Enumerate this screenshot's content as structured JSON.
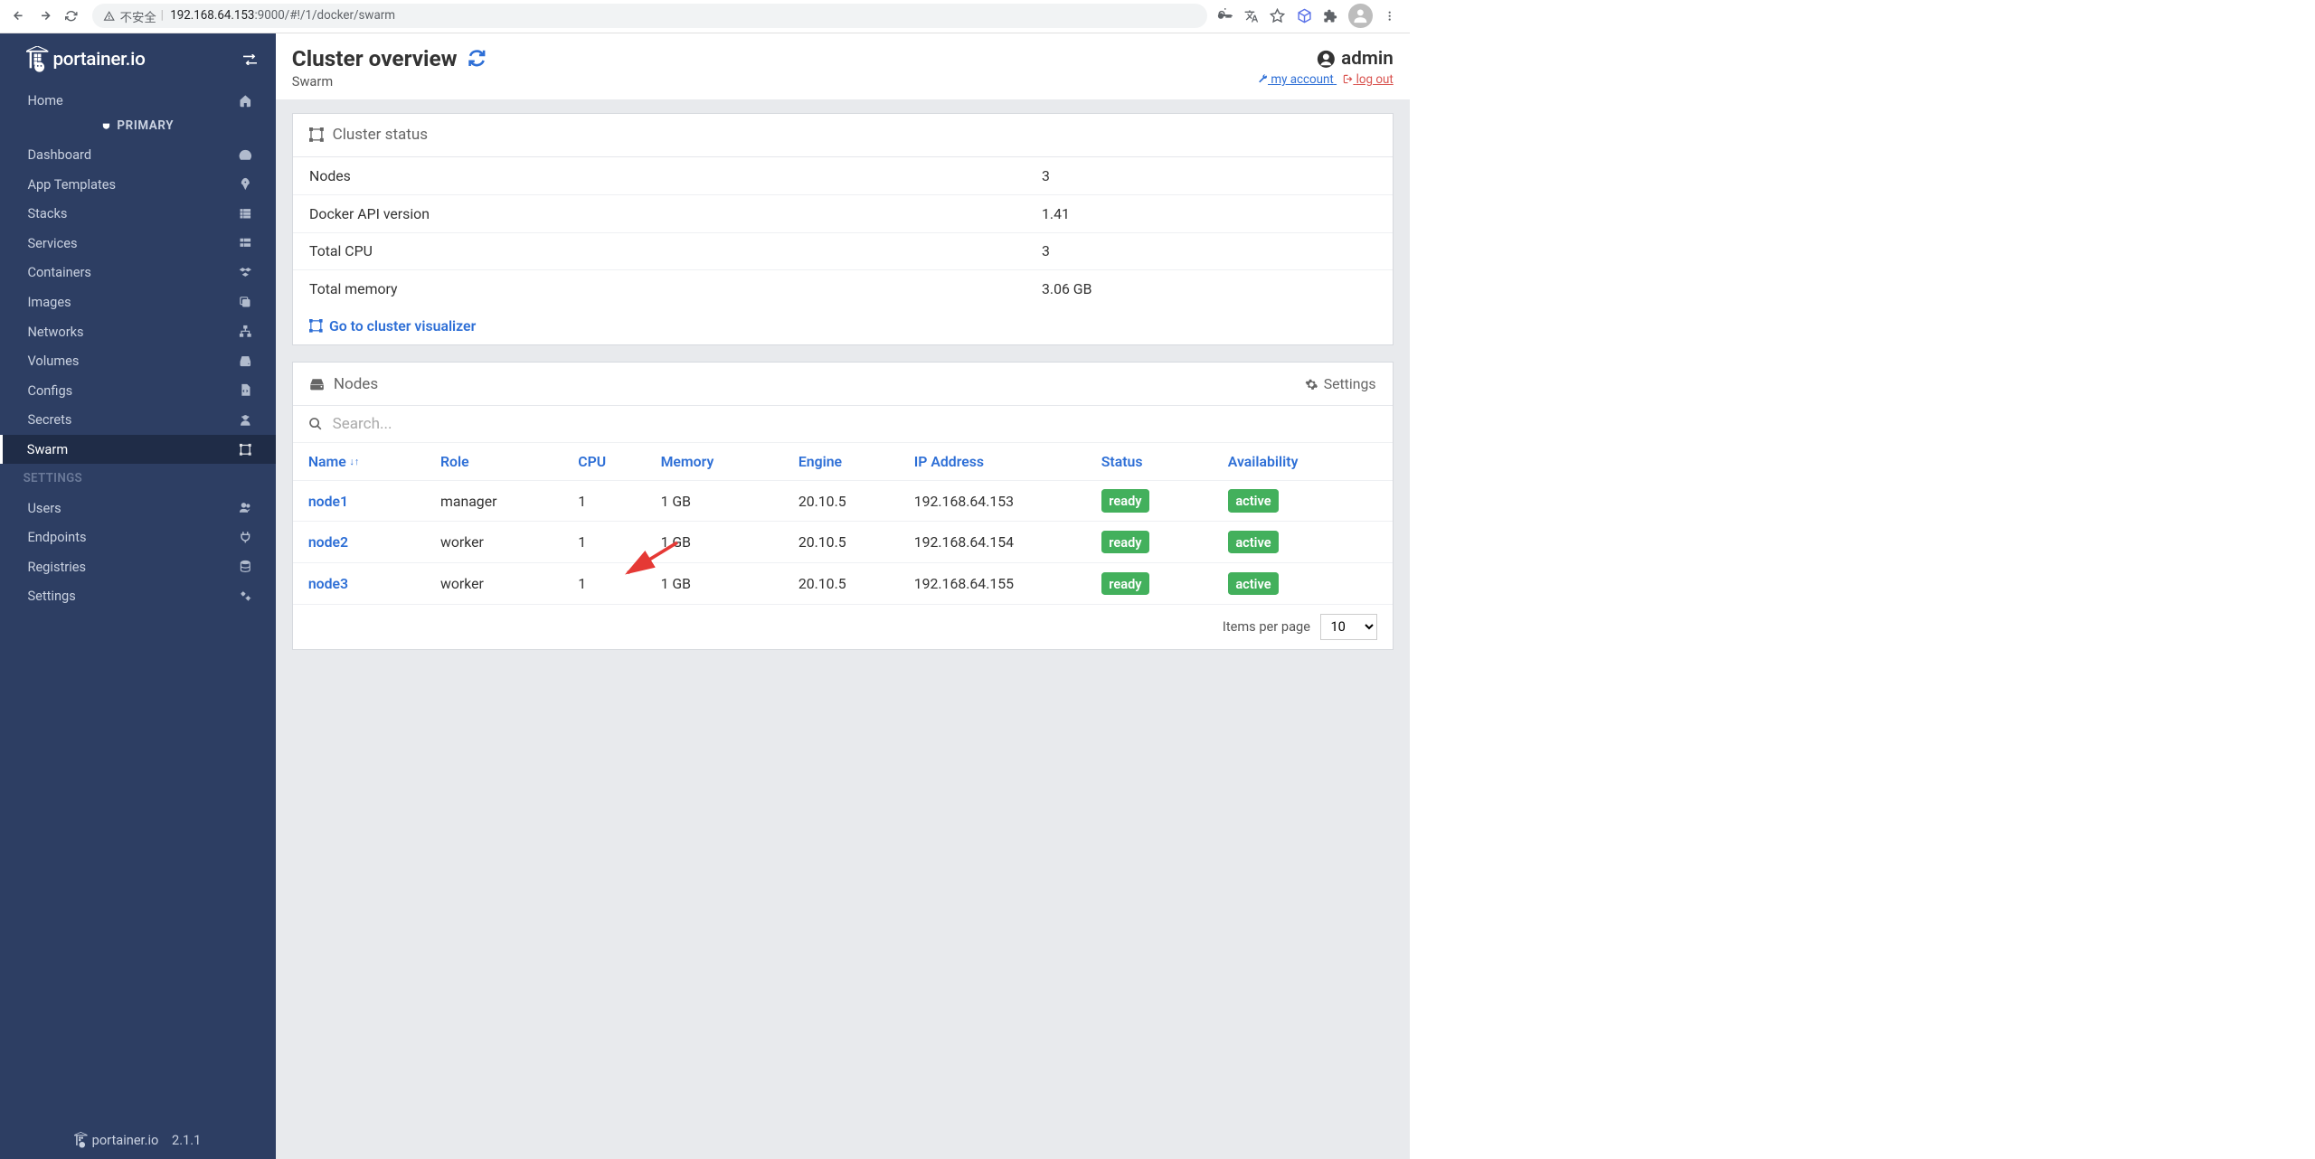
{
  "browser": {
    "insecure_label": "不安全",
    "url_host": "192.168.64.153",
    "url_port": ":9000",
    "url_path": "/#!/1/docker/swarm"
  },
  "sidebar": {
    "logo": "portainer.io",
    "env_label": "PRIMARY",
    "items": [
      {
        "label": "Home",
        "icon": "home"
      },
      {
        "label": "Dashboard",
        "icon": "tachometer"
      },
      {
        "label": "App Templates",
        "icon": "rocket"
      },
      {
        "label": "Stacks",
        "icon": "list"
      },
      {
        "label": "Services",
        "icon": "th-list"
      },
      {
        "label": "Containers",
        "icon": "cubes"
      },
      {
        "label": "Images",
        "icon": "clone"
      },
      {
        "label": "Networks",
        "icon": "sitemap"
      },
      {
        "label": "Volumes",
        "icon": "hdd"
      },
      {
        "label": "Configs",
        "icon": "file-code"
      },
      {
        "label": "Secrets",
        "icon": "user-secret"
      },
      {
        "label": "Swarm",
        "icon": "object-group"
      }
    ],
    "settings_label": "SETTINGS",
    "settings_items": [
      {
        "label": "Users",
        "icon": "users"
      },
      {
        "label": "Endpoints",
        "icon": "plug"
      },
      {
        "label": "Registries",
        "icon": "database"
      },
      {
        "label": "Settings",
        "icon": "cogs"
      }
    ],
    "footer_version": "2.1.1",
    "footer_logo": "portainer.io"
  },
  "header": {
    "title": "Cluster overview",
    "breadcrumb": "Swarm",
    "user": "admin",
    "my_account": "my account",
    "log_out": "log out"
  },
  "status_panel": {
    "title": "Cluster status",
    "rows": [
      {
        "key": "Nodes",
        "val": "3"
      },
      {
        "key": "Docker API version",
        "val": "1.41"
      },
      {
        "key": "Total CPU",
        "val": "3"
      },
      {
        "key": "Total memory",
        "val": "3.06 GB"
      }
    ],
    "visualizer": "Go to cluster visualizer"
  },
  "nodes_panel": {
    "title": "Nodes",
    "settings_label": "Settings",
    "search_placeholder": "Search...",
    "columns": [
      "Name",
      "Role",
      "CPU",
      "Memory",
      "Engine",
      "IP Address",
      "Status",
      "Availability"
    ],
    "rows": [
      {
        "name": "node1",
        "role": "manager",
        "cpu": "1",
        "memory": "1 GB",
        "engine": "20.10.5",
        "ip": "192.168.64.153",
        "status": "ready",
        "availability": "active"
      },
      {
        "name": "node2",
        "role": "worker",
        "cpu": "1",
        "memory": "1 GB",
        "engine": "20.10.5",
        "ip": "192.168.64.154",
        "status": "ready",
        "availability": "active"
      },
      {
        "name": "node3",
        "role": "worker",
        "cpu": "1",
        "memory": "1 GB",
        "engine": "20.10.5",
        "ip": "192.168.64.155",
        "status": "ready",
        "availability": "active"
      }
    ],
    "ipp_label": "Items per page",
    "ipp_value": "10"
  }
}
